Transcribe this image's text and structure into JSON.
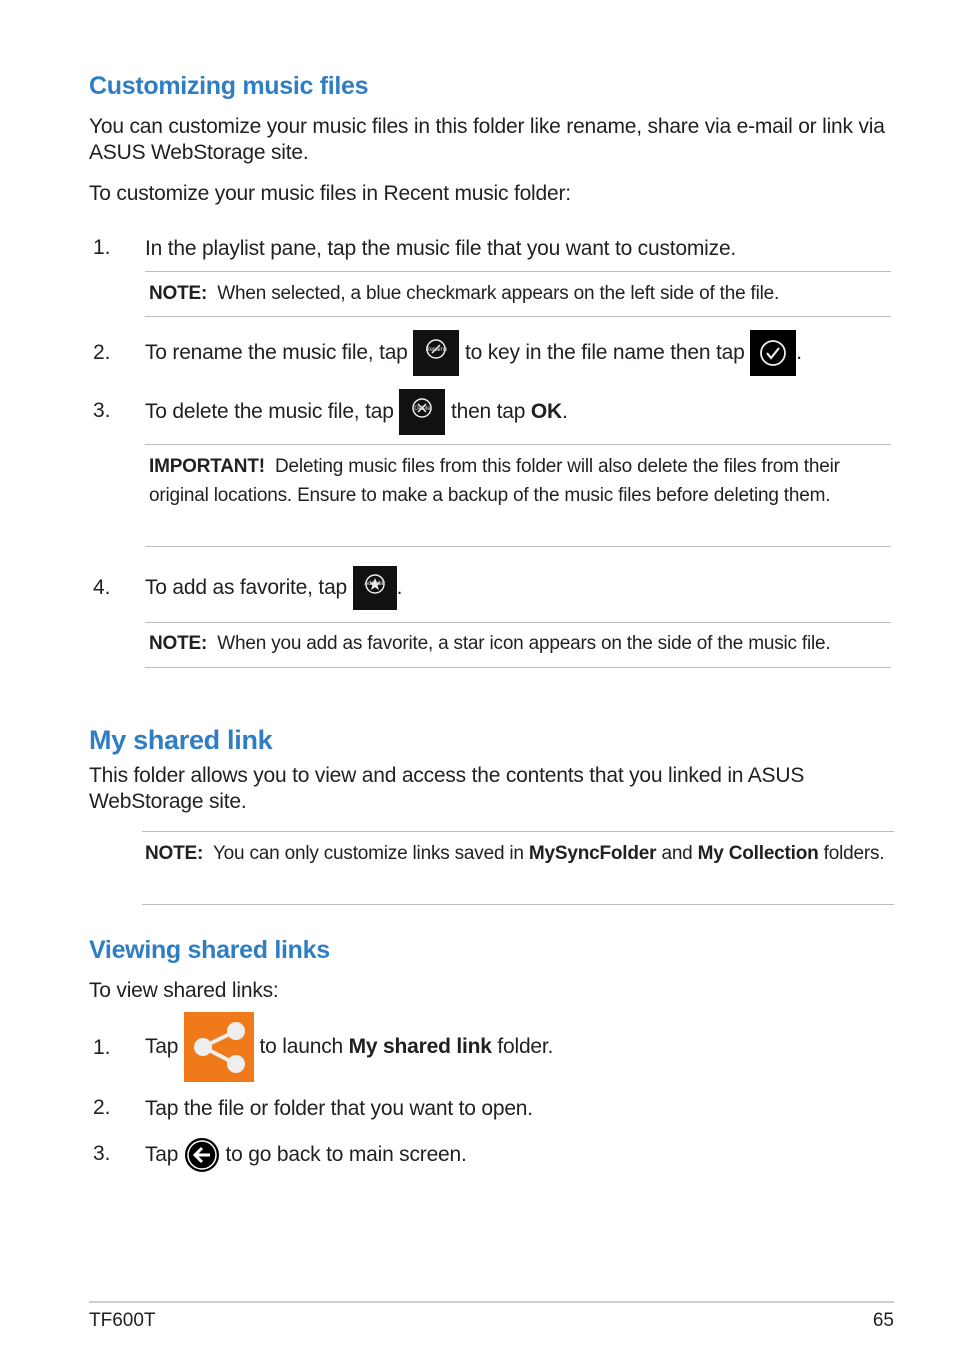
{
  "section1": {
    "heading": "Customizing music files",
    "intro": "You can customize your music files in this folder like rename, share via e-mail or link via ASUS WebStorage site.",
    "lead": "To customize your music files in Recent music folder:",
    "steps": [
      {
        "num": "1.",
        "text": "In the playlist pane, tap the music file that you want to customize."
      },
      {
        "num": "2.",
        "text_a": "To rename the music file, tap",
        "text_b": "to key in the file name then tap",
        "text_c": ".",
        "icon1_label": "Rename"
      },
      {
        "num": "3.",
        "text_a": "To delete the music file, tap",
        "text_b": "then tap",
        "bold": "OK",
        "text_c": ".",
        "icon_label": "Delete"
      },
      {
        "num": "4.",
        "text_a": "To add as favorite, tap",
        "text_c": ".",
        "icon_label": "Add star"
      }
    ],
    "note1": {
      "label": "NOTE:",
      "text": "When selected, a blue checkmark appears on the left side of the file."
    },
    "important": {
      "label": "IMPORTANT!",
      "text": "Deleting music files from this folder will also delete the files from their original locations. Ensure to make a backup of the music files before deleting them."
    },
    "note2": {
      "label": "NOTE:",
      "text": "When you add as favorite, a star icon appears on the side of the music file."
    }
  },
  "section2": {
    "heading": "My shared link",
    "intro": "This folder allows you to view and access the contents that you linked in ASUS WebStorage site.",
    "note": {
      "label": "NOTE:",
      "text_a": "You can only customize links saved in",
      "bold1": "MySyncFolder",
      "text_b": "and",
      "bold2": "My Collection",
      "text_c": "folders."
    }
  },
  "section3": {
    "heading": "Viewing shared links",
    "lead": "To view shared links:",
    "steps": [
      {
        "num": "1.",
        "text_a": "Tap",
        "text_b": "to launch",
        "bold": "My shared link",
        "text_c": "folder."
      },
      {
        "num": "2.",
        "text": "Tap the file or folder that you want to open."
      },
      {
        "num": "3.",
        "text_a": "Tap",
        "text_b": "to go back to main screen."
      }
    ]
  },
  "footer": {
    "model": "TF600T",
    "page": "65"
  },
  "colors": {
    "heading": "#2f7ec4",
    "share_tile": "#f07a1a"
  }
}
